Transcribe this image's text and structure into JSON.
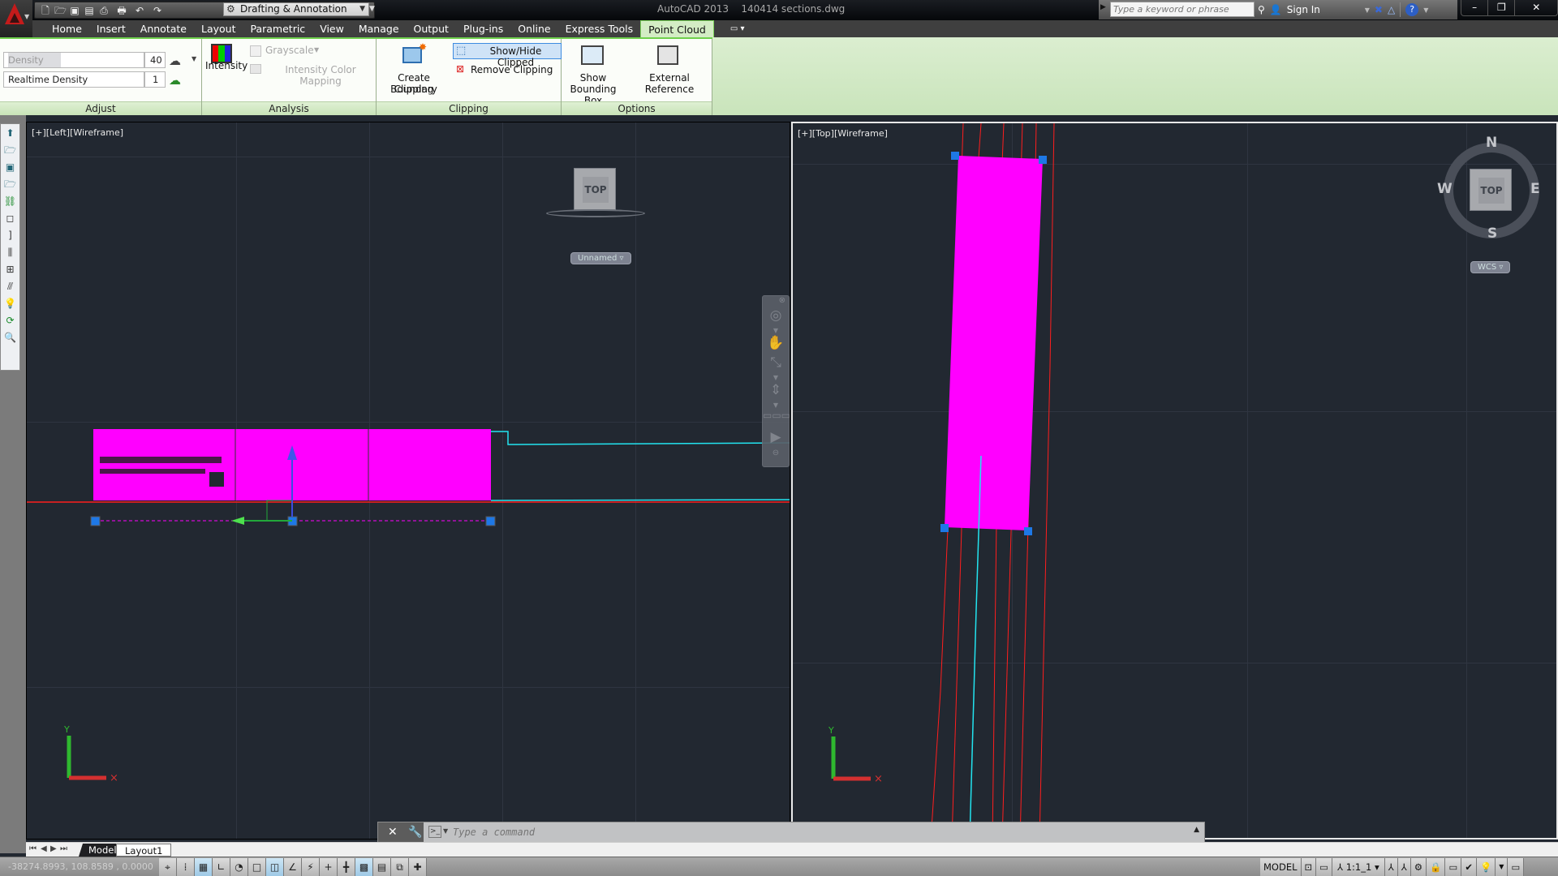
{
  "titlebar": {
    "app_name": "AutoCAD 2013",
    "file_name": "140414 sections.dwg",
    "workspace": "Drafting & Annotation",
    "search_placeholder": "Type a keyword or phrase",
    "sign_in": "Sign In"
  },
  "quick_access": [
    "new-icon",
    "open-icon",
    "save-icon",
    "save-as-icon",
    "publish-icon",
    "plot-icon",
    "undo-icon",
    "redo-icon"
  ],
  "ribbon_tabs": [
    {
      "label": "Home"
    },
    {
      "label": "Insert"
    },
    {
      "label": "Annotate"
    },
    {
      "label": "Layout"
    },
    {
      "label": "Parametric"
    },
    {
      "label": "View"
    },
    {
      "label": "Manage"
    },
    {
      "label": "Output"
    },
    {
      "label": "Plug-ins"
    },
    {
      "label": "Online"
    },
    {
      "label": "Express Tools"
    },
    {
      "label": "Point Cloud",
      "active": true
    }
  ],
  "ribbon": {
    "adjust": {
      "title": "Adjust",
      "density_label": "Density",
      "density_value": "40",
      "realtime_label": "Realtime Density",
      "realtime_value": "1"
    },
    "analysis": {
      "title": "Analysis",
      "intensity": "Intensity",
      "grayscale": "Grayscale",
      "intensity_color_mapping": "Intensity Color Mapping"
    },
    "clipping": {
      "title": "Clipping",
      "create": "Create Clipping",
      "create2": "Boundary",
      "show_hide": "Show/Hide Clipped",
      "remove": "Remove Clipping"
    },
    "options": {
      "title": "Options",
      "show_bbox": "Show",
      "show_bbox2": "Bounding Box",
      "xref": "External Reference"
    }
  },
  "viewports": {
    "left": {
      "label": "[+][Left][Wireframe]",
      "viewcube": "TOP",
      "ucs": "Unnamed"
    },
    "right": {
      "label": "[+][Top][Wireframe]",
      "viewcube": "TOP",
      "ucs": "WCS",
      "compass": {
        "n": "N",
        "s": "S",
        "e": "E",
        "w": "W"
      }
    }
  },
  "colors": {
    "point_cloud": "#ff00ff",
    "section_line": "#ff1e1e",
    "profile_line": "#22e4f0",
    "grip": "#1e78e6",
    "ribbon_accent": "#6fd04c"
  },
  "command_line": {
    "placeholder": "Type a command"
  },
  "layout_tabs": [
    {
      "label": "Model",
      "active": true
    },
    {
      "label": "Layout1"
    }
  ],
  "status": {
    "coordinates": "-38274.8993, 108.8589 , 0.0000",
    "model": "MODEL",
    "annotation_scale": "1:1_1"
  }
}
